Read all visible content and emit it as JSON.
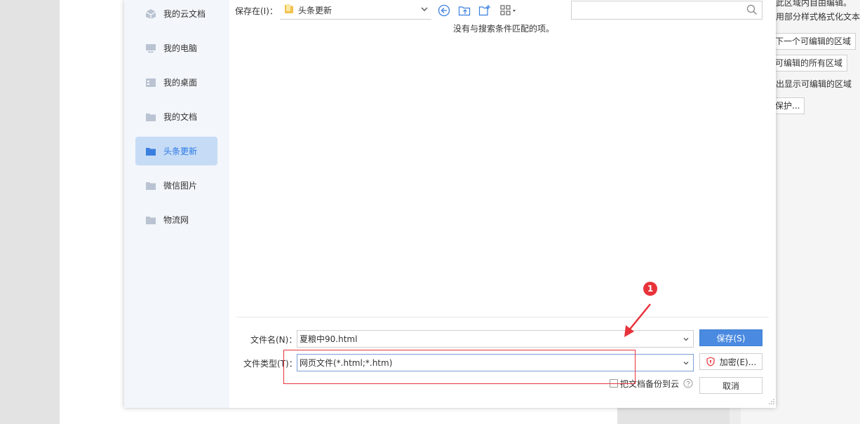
{
  "background": {
    "right_pane": {
      "line1": "此区域内自由编辑。",
      "line2": "用部分样式格式化文本",
      "btn_next": "下一个可编辑的区域",
      "btn_all": "可编辑的所有区域",
      "line3": "出显示可编辑的区域",
      "btn_protect": "保护..."
    }
  },
  "dialog": {
    "sidebar": {
      "items": [
        {
          "label": "我的云文档",
          "icon": "cloud-doc-icon"
        },
        {
          "label": "我的电脑",
          "icon": "computer-icon"
        },
        {
          "label": "我的桌面",
          "icon": "desktop-icon"
        },
        {
          "label": "我的文档",
          "icon": "folder-icon"
        },
        {
          "label": "头条更新",
          "icon": "folder-icon",
          "active": true
        },
        {
          "label": "微信图片",
          "icon": "folder-icon"
        },
        {
          "label": "物流网",
          "icon": "folder-icon"
        }
      ]
    },
    "toolbar": {
      "save_in_label": "保存在(I)：",
      "location": "头条更新",
      "search_placeholder": ""
    },
    "empty_message": "没有与搜索条件匹配的项。",
    "filename_label": "文件名(N)：",
    "filename_value": "夏粮中90.html",
    "filetype_label": "文件类型(T)：",
    "filetype_value": "网页文件(*.html;*.htm)",
    "save_button": "保存(S)",
    "encrypt_button": "加密(E)...",
    "cancel_button": "取消",
    "backup_label": "把文档备份到云"
  },
  "annotation": {
    "number": "1"
  },
  "colors": {
    "accent": "#4a8ae0",
    "annotation": "#e8333b",
    "sidebar_active": "#c6dcf6"
  }
}
